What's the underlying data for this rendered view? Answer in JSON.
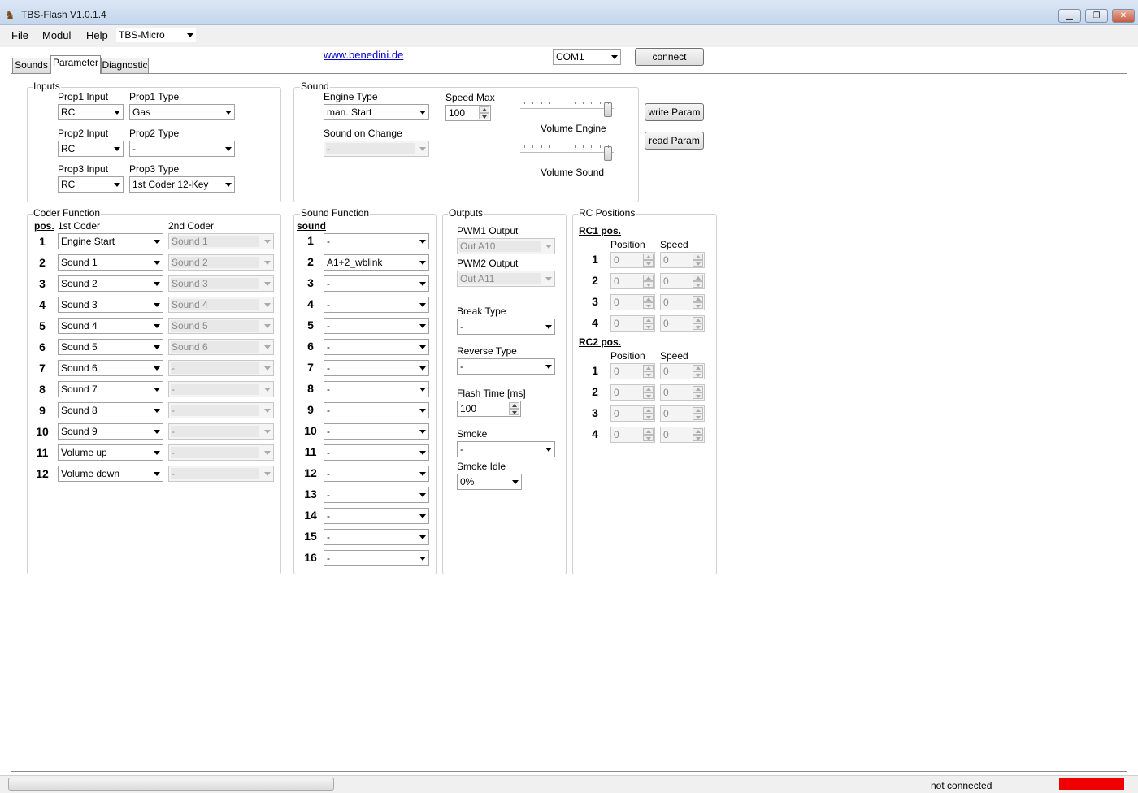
{
  "window": {
    "title": "TBS-Flash V1.0.1.4",
    "min": "▁",
    "restore": "❐",
    "close": "✕"
  },
  "menu": {
    "file": "File",
    "modul": "Modul",
    "help": "Help",
    "device": "TBS-Micro"
  },
  "tabs": [
    "Sounds",
    "Parameter",
    "Diagnostic"
  ],
  "link": "www.benedini.de",
  "port": "COM1",
  "connect_label": "connect",
  "write_label": "write Param",
  "read_label": "read Param",
  "inputs": {
    "title": "Inputs",
    "prop1_input_label": "Prop1 Input",
    "prop1_input": "RC",
    "prop1_type_label": "Prop1 Type",
    "prop1_type": "Gas",
    "prop2_input_label": "Prop2 Input",
    "prop2_input": "RC",
    "prop2_type_label": "Prop2 Type",
    "prop2_type": "-",
    "prop3_input_label": "Prop3 Input",
    "prop3_input": "RC",
    "prop3_type_label": "Prop3 Type",
    "prop3_type": "1st Coder 12-Key"
  },
  "sound": {
    "title": "Sound",
    "engine_type_label": "Engine Type",
    "engine_type": "man. Start",
    "speed_max_label": "Speed Max",
    "speed_max": "100",
    "sound_on_change_label": "Sound on Change",
    "sound_on_change": "-",
    "volume_engine_label": "Volume Engine",
    "volume_engine": 1.0,
    "volume_sound_label": "Volume Sound",
    "volume_sound": 1.0
  },
  "coder": {
    "title": "Coder Function",
    "pos_header": "pos.",
    "first_header": "1st Coder",
    "second_header": "2nd Coder",
    "rows": [
      {
        "n": "1",
        "first": "Engine Start",
        "second": "Sound 1"
      },
      {
        "n": "2",
        "first": "Sound 1",
        "second": "Sound 2"
      },
      {
        "n": "3",
        "first": "Sound 2",
        "second": "Sound 3"
      },
      {
        "n": "4",
        "first": "Sound 3",
        "second": "Sound 4"
      },
      {
        "n": "5",
        "first": "Sound 4",
        "second": "Sound 5"
      },
      {
        "n": "6",
        "first": "Sound 5",
        "second": "Sound 6"
      },
      {
        "n": "7",
        "first": "Sound 6",
        "second": "-"
      },
      {
        "n": "8",
        "first": "Sound 7",
        "second": "-"
      },
      {
        "n": "9",
        "first": "Sound 8",
        "second": "-"
      },
      {
        "n": "10",
        "first": "Sound 9",
        "second": "-"
      },
      {
        "n": "11",
        "first": "Volume up",
        "second": "-"
      },
      {
        "n": "12",
        "first": "Volume down",
        "second": "-"
      }
    ]
  },
  "soundfn": {
    "title": "Sound Function",
    "header": "sound",
    "rows": [
      {
        "n": "1",
        "v": "-"
      },
      {
        "n": "2",
        "v": "A1+2_wblink"
      },
      {
        "n": "3",
        "v": "-"
      },
      {
        "n": "4",
        "v": "-"
      },
      {
        "n": "5",
        "v": "-"
      },
      {
        "n": "6",
        "v": "-"
      },
      {
        "n": "7",
        "v": "-"
      },
      {
        "n": "8",
        "v": "-"
      },
      {
        "n": "9",
        "v": "-"
      },
      {
        "n": "10",
        "v": "-"
      },
      {
        "n": "11",
        "v": "-"
      },
      {
        "n": "12",
        "v": "-"
      },
      {
        "n": "13",
        "v": "-"
      },
      {
        "n": "14",
        "v": "-"
      },
      {
        "n": "15",
        "v": "-"
      },
      {
        "n": "16",
        "v": "-"
      }
    ]
  },
  "outputs": {
    "title": "Outputs",
    "pwm1_label": "PWM1 Output",
    "pwm1": "Out A10",
    "pwm2_label": "PWM2 Output",
    "pwm2": "Out A11",
    "break_label": "Break Type",
    "break": "-",
    "reverse_label": "Reverse Type",
    "reverse": "-",
    "flash_label": "Flash Time [ms]",
    "flash": "100",
    "smoke_label": "Smoke",
    "smoke": "-",
    "smoke_idle_label": "Smoke Idle",
    "smoke_idle": "0%"
  },
  "rc": {
    "title": "RC Positions",
    "rc1_label": "RC1 pos.",
    "rc2_label": "RC2 pos.",
    "position_header": "Position",
    "speed_header": "Speed",
    "rc1": [
      {
        "n": "1",
        "pos": "0",
        "spd": "0"
      },
      {
        "n": "2",
        "pos": "0",
        "spd": "0"
      },
      {
        "n": "3",
        "pos": "0",
        "spd": "0"
      },
      {
        "n": "4",
        "pos": "0",
        "spd": "0"
      }
    ],
    "rc2": [
      {
        "n": "1",
        "pos": "0",
        "spd": "0"
      },
      {
        "n": "2",
        "pos": "0",
        "spd": "0"
      },
      {
        "n": "3",
        "pos": "0",
        "spd": "0"
      },
      {
        "n": "4",
        "pos": "0",
        "spd": "0"
      }
    ]
  },
  "status": {
    "text": "not connected",
    "indicator_color": "#ee0000",
    "progress": 0
  },
  "colors": {
    "link": "#0000cc"
  }
}
